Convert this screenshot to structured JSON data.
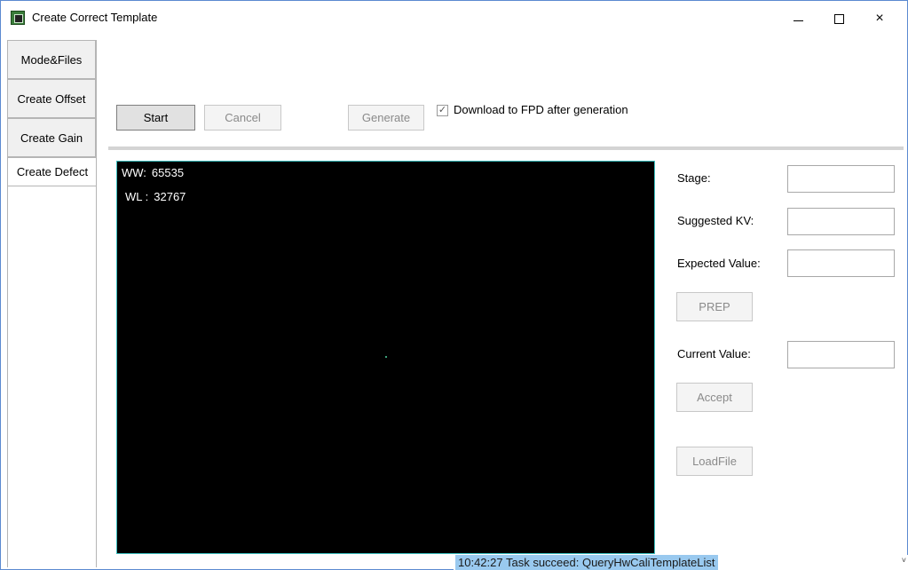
{
  "window": {
    "title": "Create Correct Template",
    "controls": {
      "minimize": "minimize",
      "maximize": "maximize",
      "close": "×"
    }
  },
  "tabs": [
    {
      "label": "Mode&Files",
      "selected": false
    },
    {
      "label": "Create Offset",
      "selected": false
    },
    {
      "label": "Create Gain",
      "selected": false
    },
    {
      "label": "Create Defect",
      "selected": true
    }
  ],
  "toolbar": {
    "start_label": "Start",
    "cancel_label": "Cancel",
    "generate_label": "Generate",
    "download_checkbox": {
      "label": "Download to FPD after generation",
      "checked": true,
      "check_glyph": "✓"
    }
  },
  "image_view": {
    "ww_label": "WW:",
    "ww_value": "65535",
    "wl_label": "WL :",
    "wl_value": "32767"
  },
  "panel": {
    "stage_label": "Stage:",
    "stage_value": "",
    "suggested_kv_label": "Suggested KV:",
    "suggested_kv_value": "",
    "expected_value_label": "Expected Value:",
    "expected_value_value": "",
    "prep_label": "PREP",
    "current_value_label": "Current Value:",
    "current_value_value": "",
    "accept_label": "Accept",
    "loadfile_label": "LoadFile"
  },
  "status": {
    "text": "10:42:27 Task succeed: QueryHwCaliTemplateList",
    "arrow": "˅"
  },
  "colors": {
    "window_border": "#5b8ad1",
    "image_border": "#3cc0c0",
    "status_highlight": "#99c9ef"
  }
}
